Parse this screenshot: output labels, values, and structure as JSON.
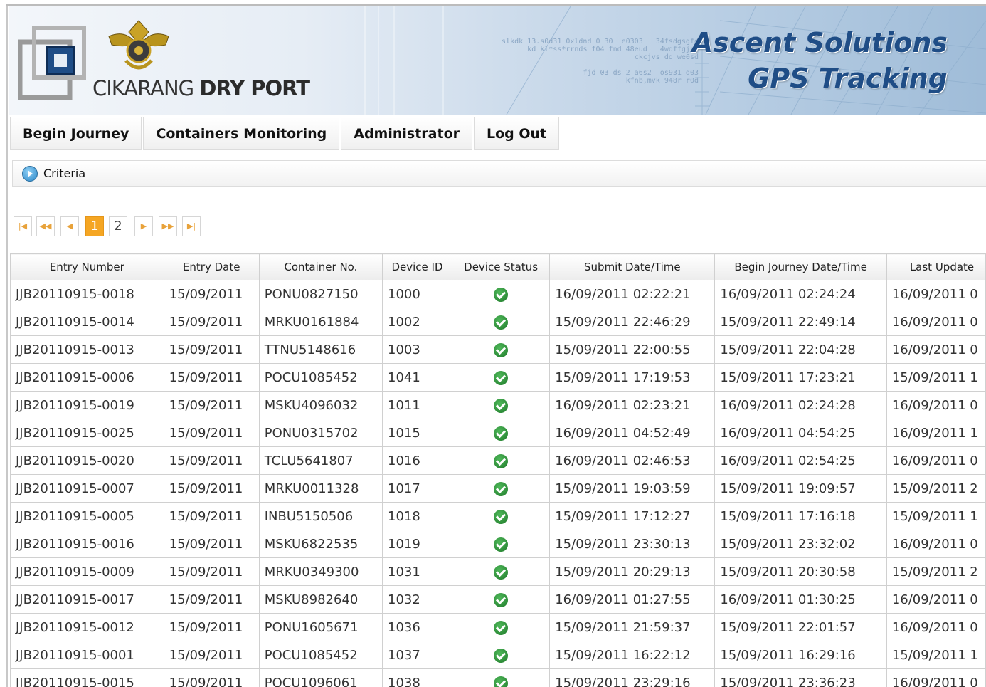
{
  "banner": {
    "brand_light": "CIKARANG",
    "brand_bold": "DRY PORT",
    "company_line1": "Ascent Solutions",
    "company_line2": "GPS Tracking"
  },
  "nav": {
    "begin_journey": "Begin Journey",
    "containers_monitoring": "Containers Monitoring",
    "administrator": "Administrator",
    "log_out": "Log Out"
  },
  "criteria": {
    "label": "Criteria"
  },
  "pager": {
    "first": "|◀",
    "prev_group": "◀◀",
    "prev": "◀",
    "pages": [
      "1",
      "2"
    ],
    "current_page": "1",
    "next": "▶",
    "next_group": "▶▶",
    "last": "▶|"
  },
  "table": {
    "columns": [
      "Entry Number",
      "Entry Date",
      "Container No.",
      "Device ID",
      "Device Status",
      "Submit Date/Time",
      "Begin Journey Date/Time",
      "Last Update"
    ],
    "rows": [
      [
        "JJB20110915-0018",
        "15/09/2011",
        "PONU0827150",
        "1000",
        "ok",
        "16/09/2011 02:22:21",
        "16/09/2011 02:24:24",
        "16/09/2011 0"
      ],
      [
        "JJB20110915-0014",
        "15/09/2011",
        "MRKU0161884",
        "1002",
        "ok",
        "15/09/2011 22:46:29",
        "15/09/2011 22:49:14",
        "16/09/2011 0"
      ],
      [
        "JJB20110915-0013",
        "15/09/2011",
        "TTNU5148616",
        "1003",
        "ok",
        "15/09/2011 22:00:55",
        "15/09/2011 22:04:28",
        "16/09/2011 0"
      ],
      [
        "JJB20110915-0006",
        "15/09/2011",
        "POCU1085452",
        "1041",
        "ok",
        "15/09/2011 17:19:53",
        "15/09/2011 17:23:21",
        "15/09/2011 1"
      ],
      [
        "JJB20110915-0019",
        "15/09/2011",
        "MSKU4096032",
        "1011",
        "ok",
        "16/09/2011 02:23:21",
        "16/09/2011 02:24:28",
        "16/09/2011 0"
      ],
      [
        "JJB20110915-0025",
        "15/09/2011",
        "PONU0315702",
        "1015",
        "ok",
        "16/09/2011 04:52:49",
        "16/09/2011 04:54:25",
        "16/09/2011 1"
      ],
      [
        "JJB20110915-0020",
        "15/09/2011",
        "TCLU5641807",
        "1016",
        "ok",
        "16/09/2011 02:46:53",
        "16/09/2011 02:54:25",
        "16/09/2011 0"
      ],
      [
        "JJB20110915-0007",
        "15/09/2011",
        "MRKU0011328",
        "1017",
        "ok",
        "15/09/2011 19:03:59",
        "15/09/2011 19:09:57",
        "15/09/2011 2"
      ],
      [
        "JJB20110915-0005",
        "15/09/2011",
        "INBU5150506",
        "1018",
        "ok",
        "15/09/2011 17:12:27",
        "15/09/2011 17:16:18",
        "15/09/2011 1"
      ],
      [
        "JJB20110915-0016",
        "15/09/2011",
        "MSKU6822535",
        "1019",
        "ok",
        "15/09/2011 23:30:13",
        "15/09/2011 23:32:02",
        "16/09/2011 0"
      ],
      [
        "JJB20110915-0009",
        "15/09/2011",
        "MRKU0349300",
        "1031",
        "ok",
        "15/09/2011 20:29:13",
        "15/09/2011 20:30:58",
        "15/09/2011 2"
      ],
      [
        "JJB20110915-0017",
        "15/09/2011",
        "MSKU8982640",
        "1032",
        "ok",
        "16/09/2011 01:27:55",
        "16/09/2011 01:30:25",
        "16/09/2011 0"
      ],
      [
        "JJB20110915-0012",
        "15/09/2011",
        "PONU1605671",
        "1036",
        "ok",
        "15/09/2011 21:59:37",
        "15/09/2011 22:01:57",
        "16/09/2011 0"
      ],
      [
        "JJB20110915-0001",
        "15/09/2011",
        "POCU1085452",
        "1037",
        "ok",
        "15/09/2011 16:22:12",
        "15/09/2011 16:29:16",
        "15/09/2011 1"
      ],
      [
        "JJB20110915-0015",
        "15/09/2011",
        "POCU1096061",
        "1038",
        "ok",
        "15/09/2011 23:29:16",
        "15/09/2011 23:36:23",
        "16/09/2011 0"
      ]
    ]
  },
  "icons": {
    "status_ok": "check-circle-icon",
    "criteria": "play-circle-icon"
  },
  "colors": {
    "company_text": "#1f4d86",
    "pager_active": "#f5a623",
    "status_ok": "#2e8b3a"
  }
}
